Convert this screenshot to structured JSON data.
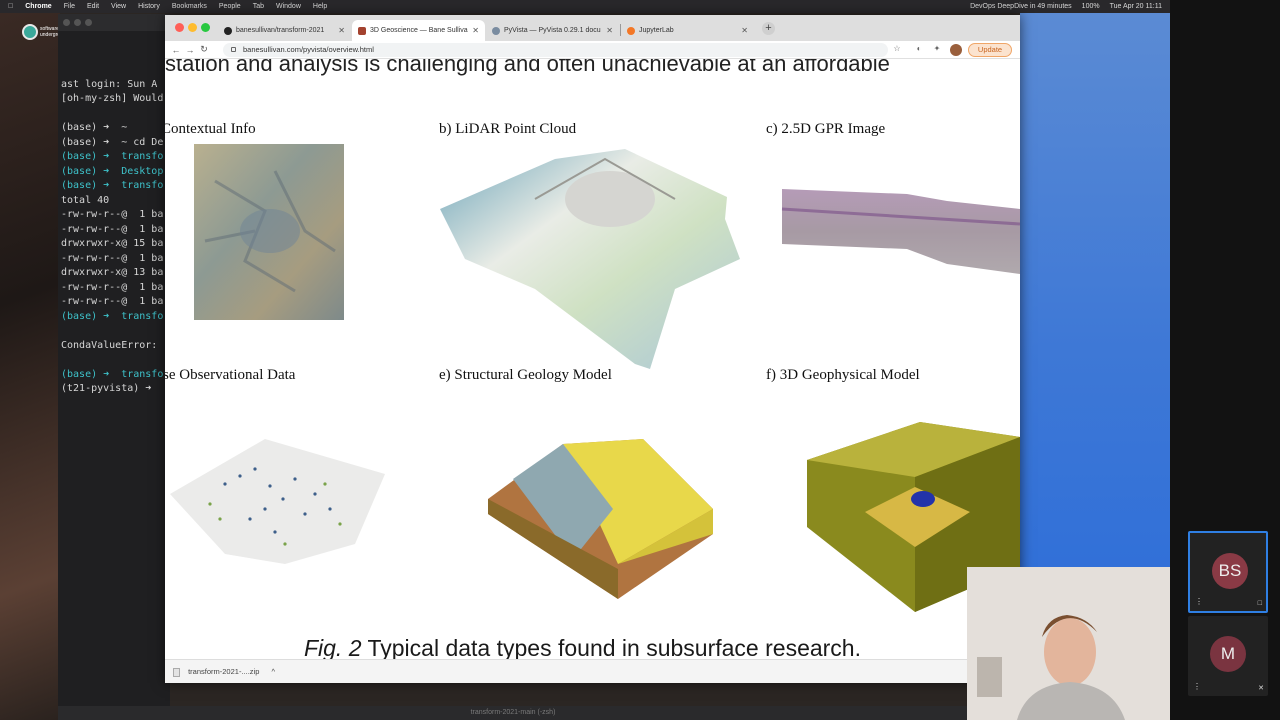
{
  "menubar": {
    "items": [
      "Chrome",
      "File",
      "Edit",
      "View",
      "History",
      "Bookmarks",
      "People",
      "Tab",
      "Window",
      "Help"
    ],
    "status_meeting": "DevOps DeepDive in 49 minutes",
    "battery": "100%",
    "clock": "Tue Apr 20 11:11"
  },
  "desktop": {
    "logo_text": "software underground"
  },
  "terminal": {
    "lines": [
      "ast login: Sun A",
      "[oh-my-zsh] Would",
      "",
      "(base) ➜  ~",
      "(base) ➜  ~ cd De",
      "(base) ➜  transfo",
      "(base) ➜  Desktop",
      "(base) ➜  transfo",
      "total 40",
      "-rw-rw-r--@  1 ba",
      "-rw-rw-r--@  1 ba",
      "drwxrwxr-x@ 15 ba",
      "-rw-rw-r--@  1 ba",
      "drwxrwxr-x@ 13 ba",
      "-rw-rw-r--@  1 ba",
      "-rw-rw-r--@  1 ba",
      "(base) ➜  transfo",
      "",
      "CondaValueError:",
      "",
      "(base) ➜  transfo",
      "(t21-pyvista) ➜"
    ],
    "footer": "transform-2021-main (-zsh)"
  },
  "browser": {
    "tabs": [
      {
        "title": "banesullivan/transform-2021",
        "icon": "github-icon"
      },
      {
        "title": "3D Geoscience — Bane Sulliva",
        "icon": "page-icon"
      },
      {
        "title": "PyVista — PyVista 0.29.1 docu",
        "icon": "pyvista-icon"
      },
      {
        "title": "JupyterLab",
        "icon": "jupyter-icon"
      }
    ],
    "new_tab": "+",
    "url": "banesullivan.com/pyvista/overview.html",
    "update_label": "Update",
    "download_name": "transform-2021-....zip",
    "download_chevron": "^"
  },
  "page": {
    "cut_text": "station and analysis is challenging and often unachievable at an affordable",
    "panels": [
      {
        "label": "Contextual Info"
      },
      {
        "label": "b) LiDAR Point Cloud"
      },
      {
        "label": "c) 2.5D GPR Image"
      },
      {
        "label": "se Observational Data"
      },
      {
        "label": "e) Structural Geology Model"
      },
      {
        "label": "f) 3D Geophysical Model"
      }
    ],
    "caption_fig": "Fig. 2",
    "caption_text": " Typical data types found in subsurface research."
  },
  "participants": [
    {
      "initials": "BS"
    },
    {
      "initials": "M"
    }
  ]
}
